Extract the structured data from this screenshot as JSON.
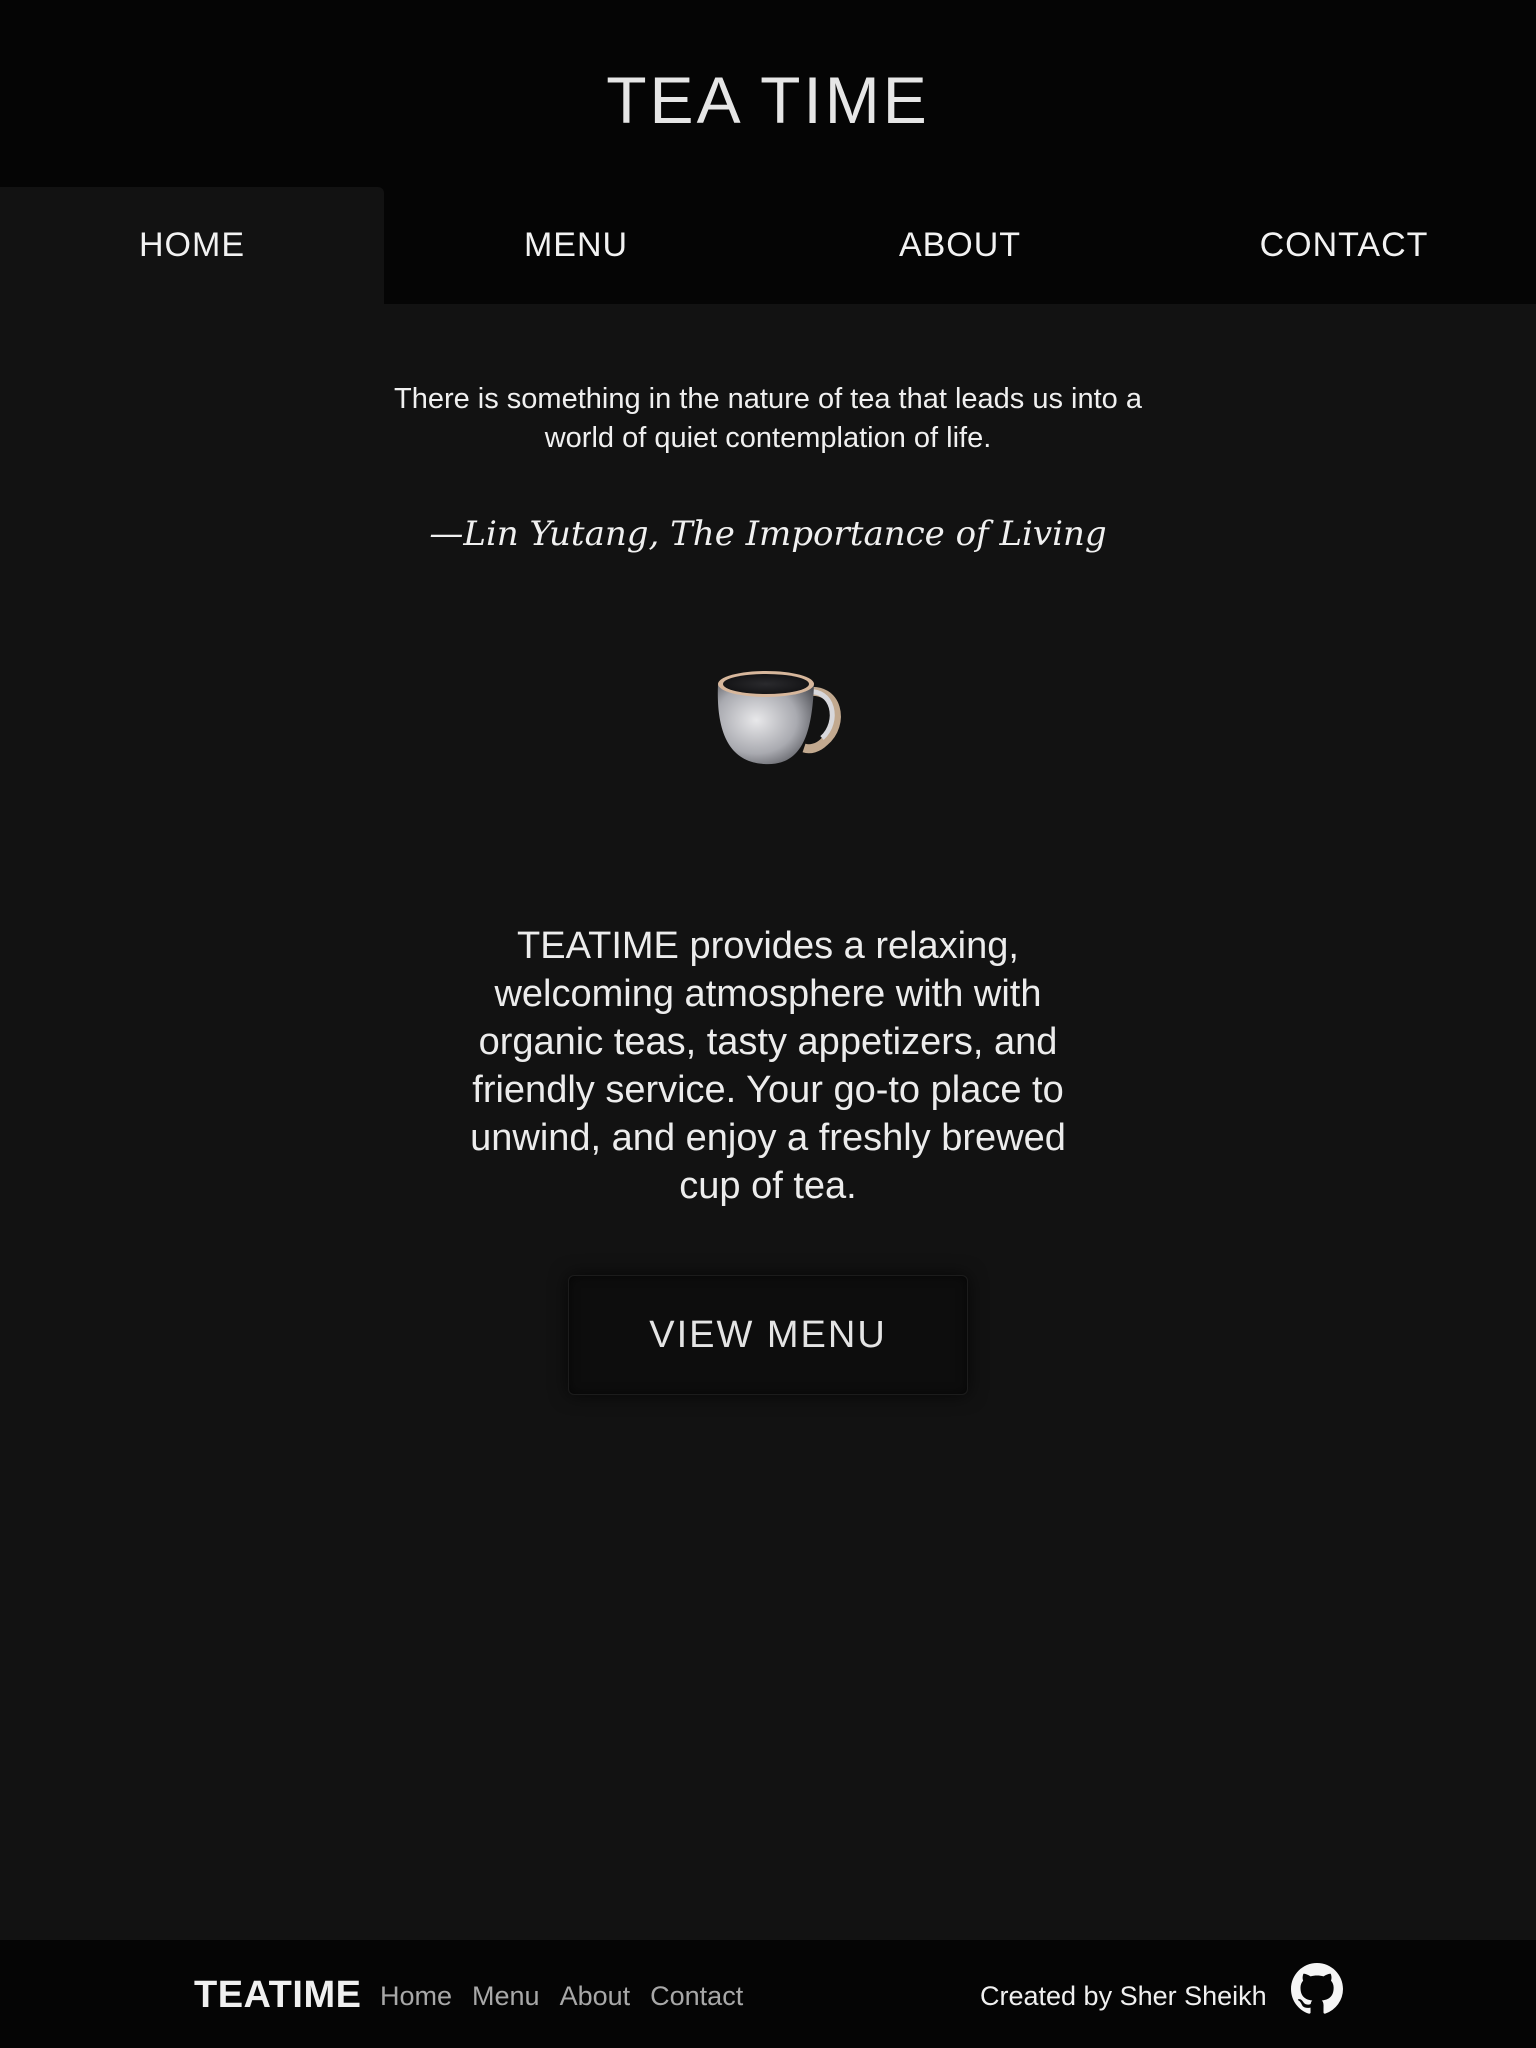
{
  "header": {
    "title": "TEA TIME"
  },
  "nav": {
    "tabs": [
      {
        "label": "HOME",
        "active": true
      },
      {
        "label": "MENU",
        "active": false
      },
      {
        "label": "ABOUT",
        "active": false
      },
      {
        "label": "CONTACT",
        "active": false
      }
    ]
  },
  "main": {
    "quote": "There is something in the nature of tea that leads us into a world of quiet contemplation of life.",
    "quote_author": "—Lin Yutang, The Importance of Living",
    "image_icon": "tea-cup-icon",
    "description": "TEATIME provides a relaxing, welcoming atmosphere with with organic teas, tasty appetizers, and friendly service. Your go-to place to unwind, and enjoy a freshly brewed cup of tea.",
    "cta_label": "VIEW MENU"
  },
  "footer": {
    "brand": "TEATIME",
    "links": [
      "Home",
      "Menu",
      "About",
      "Contact"
    ],
    "credit": "Created by Sher Sheikh",
    "icon": "github-icon"
  },
  "colors": {
    "page_background": "#121212",
    "header_background": "#050505",
    "text": "#ececec",
    "muted_link": "#a8a8a8"
  }
}
